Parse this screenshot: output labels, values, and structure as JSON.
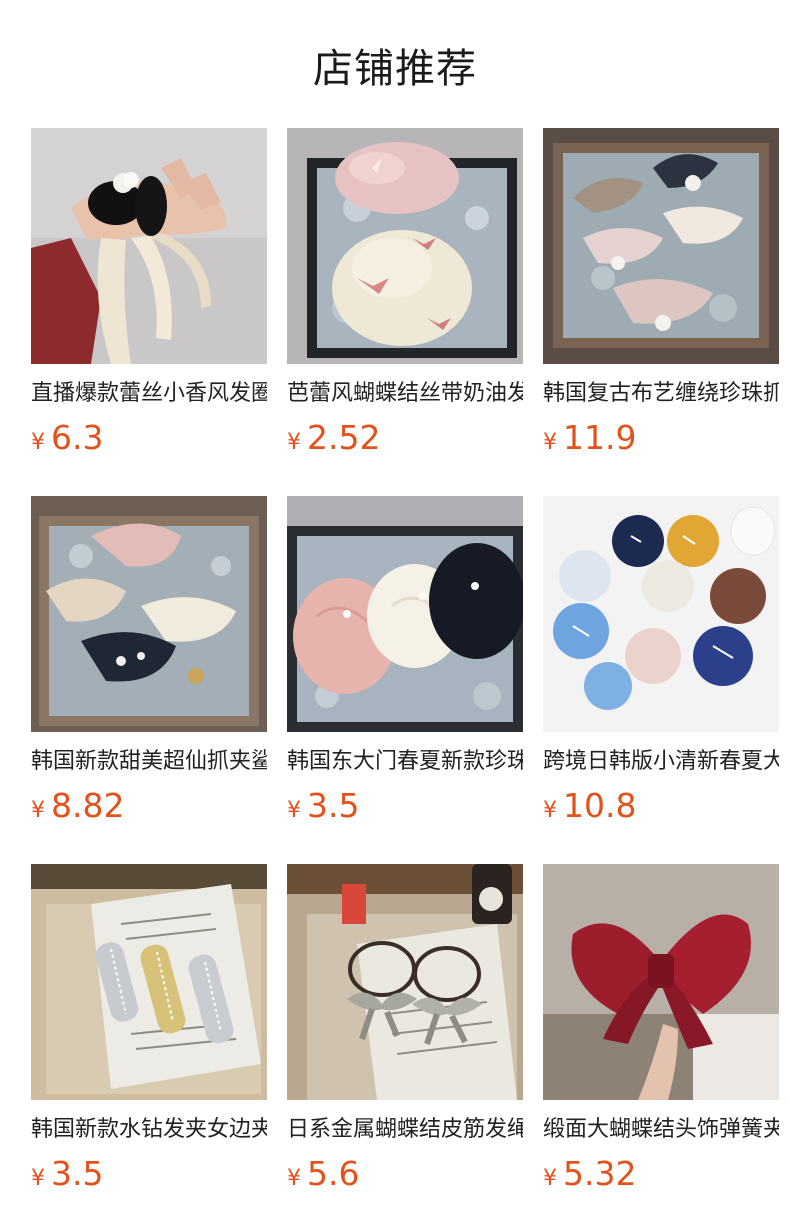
{
  "header": {
    "title": "店铺推荐"
  },
  "products": [
    {
      "name": "直播爆款蕾丝小香风发圈",
      "currency": "¥",
      "price": "6.3",
      "image": "black-scrunchie-lace-ribbon-on-hand-photo"
    },
    {
      "name": "芭蕾风蝴蝶结丝带奶油发圈",
      "currency": "¥",
      "price": "2.52",
      "image": "pink-cream-bow-scrunchies-photo"
    },
    {
      "name": "韩国复古布艺缠绕珍珠抓夹",
      "currency": "¥",
      "price": "11.9",
      "image": "pearl-fabric-claw-clips-photo"
    },
    {
      "name": "韩国新款甜美超仙抓夹鲨鱼夹",
      "currency": "¥",
      "price": "8.82",
      "image": "chiffon-claw-clips-photo"
    },
    {
      "name": "韩国东大门春夏新款珍珠发圈",
      "currency": "¥",
      "price": "3.5",
      "image": "pleated-pearl-scrunchies-photo"
    },
    {
      "name": "跨境日韩版小清新春夏大肠发圈",
      "currency": "¥",
      "price": "10.8",
      "image": "printed-scrunchies-circle-photo"
    },
    {
      "name": "韩国新款水钻发夹女边夹",
      "currency": "¥",
      "price": "3.5",
      "image": "rhinestone-hair-clips-photo"
    },
    {
      "name": "日系金属蝴蝶结皮筋发绳",
      "currency": "¥",
      "price": "5.6",
      "image": "metal-bow-hair-ties-photo"
    },
    {
      "name": "缎面大蝴蝶结头饰弹簧夹",
      "currency": "¥",
      "price": "5.32",
      "image": "red-satin-big-bow-photo"
    }
  ],
  "colors": {
    "price": "#e2531c",
    "title": "#1a1a1a",
    "text": "#222222"
  }
}
